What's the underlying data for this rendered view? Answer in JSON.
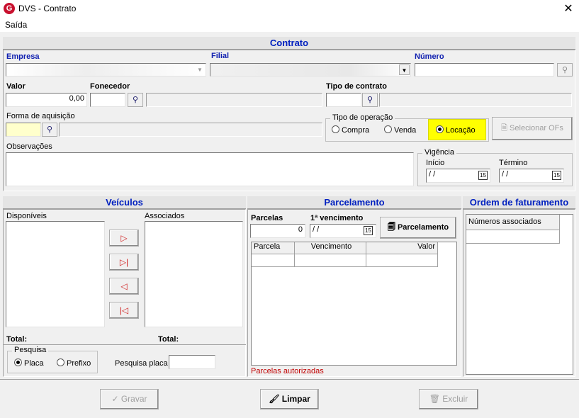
{
  "window": {
    "title": "DVS - Contrato",
    "logo_letter": "G",
    "close": "✕"
  },
  "menu": {
    "items": [
      {
        "label": "Saída"
      }
    ]
  },
  "contrato": {
    "section_title": "Contrato",
    "empresa_label": "Empresa",
    "filial_label": "Filial",
    "numero_label": "Número",
    "numero_value": "",
    "valor_label": "Valor",
    "valor_value": "0,00",
    "fornecedor_label": "Fonecedor",
    "tipo_contrato_label": "Tipo de contrato",
    "forma_aquisicao_label": "Forma de aquisição",
    "tipo_operacao": {
      "label": "Tipo de operação",
      "options": [
        {
          "label": "Compra"
        },
        {
          "label": "Venda"
        },
        {
          "label": "Locação"
        }
      ],
      "selected": "Locação",
      "highlight_color": "#ffff00"
    },
    "selecionar_ofs_label": "Selecionar OFs",
    "observacoes_label": "Observações",
    "vigencia": {
      "label": "Vigência",
      "inicio_label": "Início",
      "inicio_value": " /  /",
      "termino_label": "Término",
      "termino_value": " /  /"
    }
  },
  "veiculos": {
    "section_title": "Veículos",
    "disponiveis_label": "Disponíveis",
    "associados_label": "Associados",
    "total_label_left": "Total:",
    "total_label_right": "Total:",
    "pesquisa": {
      "label": "Pesquisa",
      "options": [
        {
          "label": "Placa"
        },
        {
          "label": "Prefixo"
        }
      ],
      "selected": "Placa"
    },
    "pesquisa_placa_label": "Pesquisa placa"
  },
  "parcelamento": {
    "section_title": "Parcelamento",
    "parcelas_label": "Parcelas",
    "parcelas_value": "0",
    "vencimento_label": "1ª vencimento",
    "vencimento_value": " /  /",
    "button_label": "Parcelamento",
    "columns": [
      "Parcela",
      "Vencimento",
      "Valor"
    ],
    "status_text": "Parcelas autorizadas",
    "status_color": "#c00000"
  },
  "ordem_faturamento": {
    "section_title": "Ordem de faturamento",
    "column": "Números associados"
  },
  "footer": {
    "gravar_label": "Gravar",
    "limpar_label": "Limpar",
    "excluir_label": "Excluir"
  },
  "colors": {
    "section_title": "#0020c0",
    "label_blue": "#1020b0"
  }
}
